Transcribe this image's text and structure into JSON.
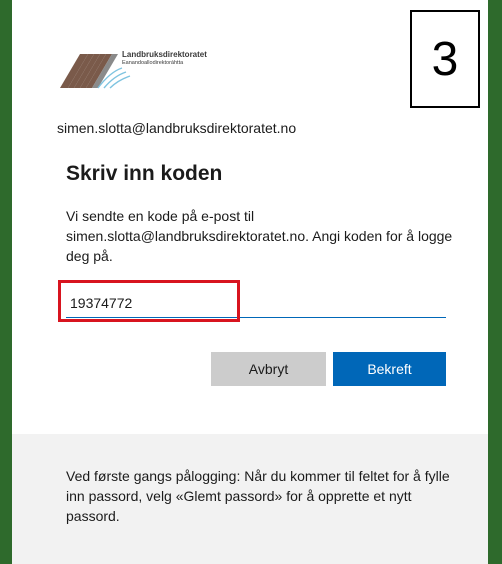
{
  "branding": {
    "org_name": "Landbruksdirektoratet",
    "org_name_sami": "Eanandoallodirektoráhtta"
  },
  "step_label": "3",
  "identity": "simen.slotta@landbruksdirektoratet.no",
  "heading": "Skriv inn koden",
  "description": "Vi sendte en kode på e-post til simen.slotta@landbruksdirektoratet.no. Angi koden for å logge deg på.",
  "code_input": {
    "value": "19374772"
  },
  "buttons": {
    "cancel": "Avbryt",
    "confirm": "Bekreft"
  },
  "footer": "Ved første gangs pålogging: Når du kommer til feltet for å fylle inn passord, velg «Glemt passord» for å opprette et nytt passord.",
  "colors": {
    "background": "#2e6a2c",
    "accent": "#0067b8",
    "highlight": "#d8141f"
  }
}
